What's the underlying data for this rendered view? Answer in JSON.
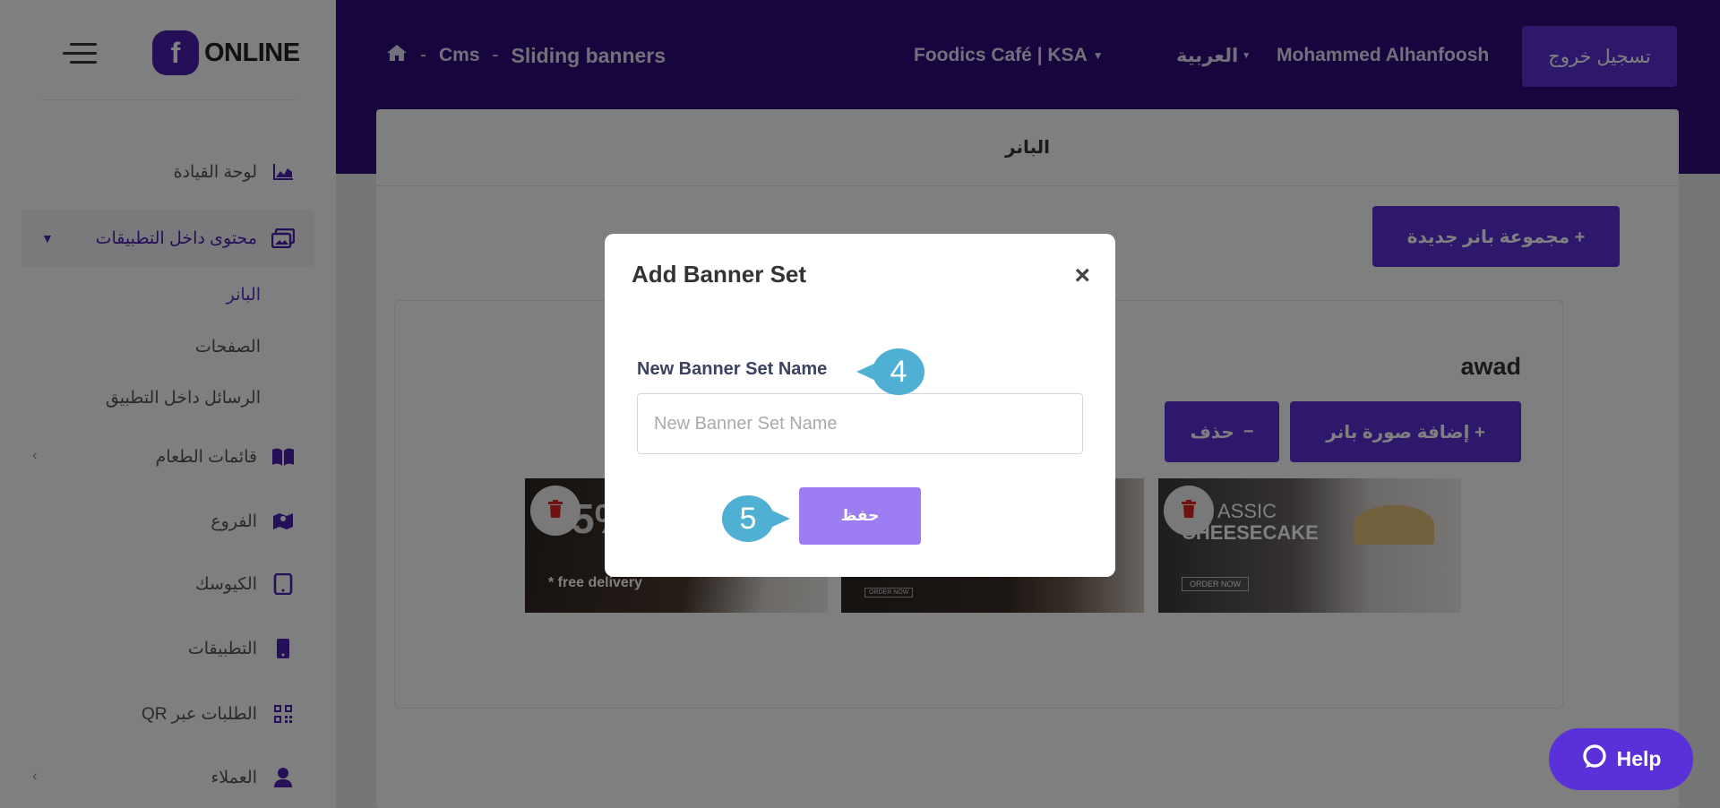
{
  "brand": {
    "logo_letter": "f",
    "logo_text": "ONLINE",
    "color": "#4b1fb0"
  },
  "header": {
    "breadcrumb": [
      "Cms",
      "Sliding banners"
    ],
    "separator": "-",
    "business": "Foodics Café | KSA",
    "language": "العربية",
    "user": "Mohammed Alhanfoosh",
    "logout_label": "تسجيل خروج"
  },
  "sidebar": {
    "items": [
      {
        "label": "لوحة القيادة",
        "icon": "chart-icon"
      },
      {
        "label": "محتوى داخل التطبيقات",
        "icon": "images-icon"
      },
      {
        "label": "البانر"
      },
      {
        "label": "الصفحات"
      },
      {
        "label": "الرسائل داخل التطبيق"
      },
      {
        "label": "قائمات الطعام",
        "icon": "book-icon"
      },
      {
        "label": "الفروع",
        "icon": "map-icon"
      },
      {
        "label": "الكيوسك",
        "icon": "tablet-icon"
      },
      {
        "label": "التطبيقات",
        "icon": "phone-icon"
      },
      {
        "label": "الطلبات عبر QR",
        "icon": "qr-icon"
      },
      {
        "label": "العملاء",
        "icon": "user-icon"
      }
    ]
  },
  "page": {
    "title": "البانر",
    "new_set_label": "+ مجموعة بانر جديدة",
    "set_name": "awad",
    "add_image_label": "+ إضافة صورة بانر",
    "delete_label": "حذف"
  },
  "banners": [
    {
      "big_text": "5%",
      "caption": "* free delivery"
    },
    {
      "button": "ORDER NOW"
    },
    {
      "line1": "ASSIC",
      "line2": "CHEESECAKE",
      "button": "ORDER NOW"
    }
  ],
  "modal": {
    "title": "Add Banner Set",
    "close": "×",
    "field_label": "New Banner Set Name",
    "field_placeholder": "New Banner Set Name",
    "field_value": "",
    "save_label": "حفظ"
  },
  "callouts": {
    "first": "4",
    "second": "5"
  },
  "help_label": "Help"
}
